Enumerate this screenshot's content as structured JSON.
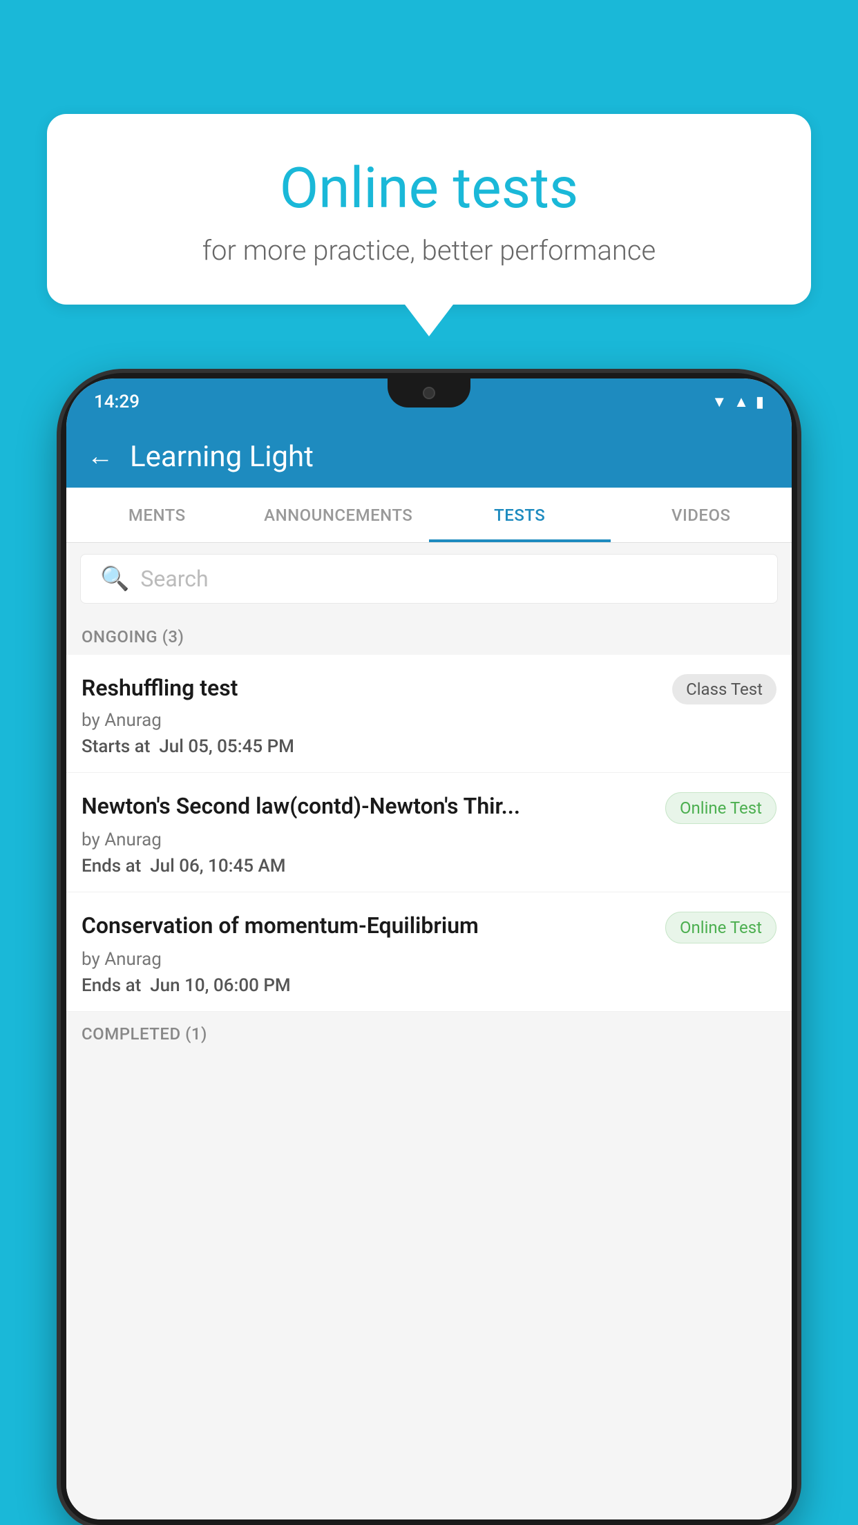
{
  "background": {
    "color": "#1ab8d8"
  },
  "bubble": {
    "title": "Online tests",
    "subtitle": "for more practice, better performance"
  },
  "phone": {
    "status_bar": {
      "time": "14:29",
      "icons": [
        "wifi",
        "signal",
        "battery"
      ]
    },
    "header": {
      "back_label": "←",
      "title": "Learning Light"
    },
    "tabs": [
      {
        "label": "MENTS",
        "active": false
      },
      {
        "label": "ANNOUNCEMENTS",
        "active": false
      },
      {
        "label": "TESTS",
        "active": true
      },
      {
        "label": "VIDEOS",
        "active": false
      }
    ],
    "search": {
      "placeholder": "Search"
    },
    "ongoing_section": {
      "header": "ONGOING (3)",
      "tests": [
        {
          "name": "Reshuffling test",
          "badge": "Class Test",
          "badge_type": "class",
          "author": "by Anurag",
          "date_label": "Starts at",
          "date": "Jul 05, 05:45 PM"
        },
        {
          "name": "Newton's Second law(contd)-Newton's Thir...",
          "badge": "Online Test",
          "badge_type": "online",
          "author": "by Anurag",
          "date_label": "Ends at",
          "date": "Jul 06, 10:45 AM"
        },
        {
          "name": "Conservation of momentum-Equilibrium",
          "badge": "Online Test",
          "badge_type": "online",
          "author": "by Anurag",
          "date_label": "Ends at",
          "date": "Jun 10, 06:00 PM"
        }
      ]
    },
    "completed_section": {
      "header": "COMPLETED (1)"
    }
  }
}
